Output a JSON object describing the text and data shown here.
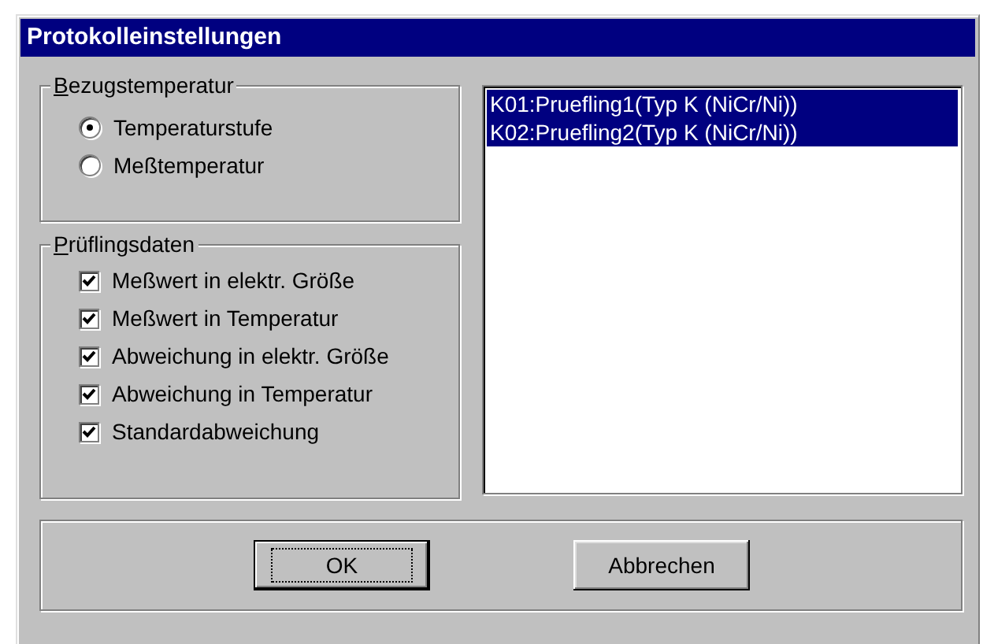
{
  "window": {
    "title": "Protokolleinstellungen"
  },
  "reference_group": {
    "title": "Bezugstemperatur",
    "options": [
      {
        "label": "Temperaturstufe",
        "selected": true
      },
      {
        "label": "Meßtemperatur",
        "selected": false
      }
    ]
  },
  "specimen_group": {
    "title": "Prüflingsdaten",
    "options": [
      {
        "label": "Meßwert in elektr. Größe",
        "checked": true
      },
      {
        "label": "Meßwert in Temperatur",
        "checked": true
      },
      {
        "label": "Abweichung in elektr. Größe",
        "checked": true
      },
      {
        "label": "Abweichung in Temperatur",
        "checked": true
      },
      {
        "label": "Standardabweichung",
        "checked": true
      }
    ]
  },
  "channel_list": [
    {
      "label": "K01:Pruefling1(Typ K (NiCr/Ni))",
      "selected": true
    },
    {
      "label": "K02:Pruefling2(Typ K (NiCr/Ni))",
      "selected": true
    }
  ],
  "buttons": [
    {
      "label": "OK",
      "default": true
    },
    {
      "label": "Abbrechen",
      "default": false
    }
  ]
}
